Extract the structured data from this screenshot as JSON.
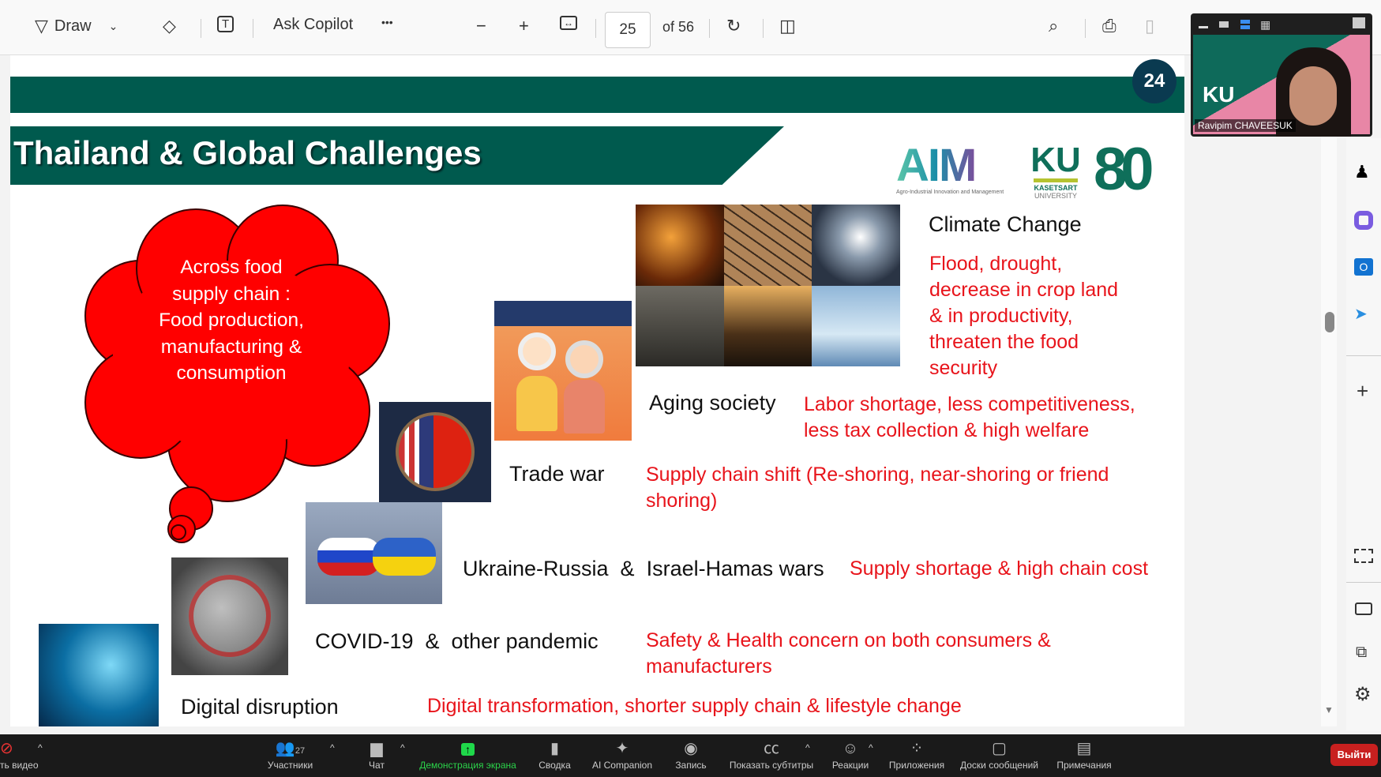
{
  "toolbar": {
    "draw": "Draw",
    "ask_copilot": "Ask Copilot",
    "more": "•••",
    "page_current": "25",
    "page_total": "of 56"
  },
  "slide": {
    "page_badge": "24",
    "title": "Thailand  & Global Challenges",
    "logos": {
      "aim": "AIM",
      "aim_sub": "Agro-Industrial Innovation and Management",
      "ku": "KU",
      "ku_sub1": "KASETSART",
      "ku_sub2": "UNIVERSITY",
      "anniv": "80"
    },
    "cloud_text": [
      "Across food",
      "supply chain :",
      "Food production,",
      "manufacturing &",
      "consumption"
    ],
    "challenges": [
      {
        "label": "Climate Change",
        "impact": [
          "Flood, drought,",
          "decrease in crop land",
          "& in productivity,",
          "threaten the food",
          "security"
        ]
      },
      {
        "label": "Aging society",
        "impact": [
          "Labor shortage, less competitiveness,",
          "less tax collection & high welfare"
        ]
      },
      {
        "label": "Trade war",
        "impact": [
          "Supply chain shift (Re-shoring, near-shoring or friend",
          "shoring)"
        ]
      },
      {
        "label": "Ukraine-Russia  &  Israel-Hamas wars",
        "impact": [
          "Supply shortage & high chain cost"
        ]
      },
      {
        "label": "COVID-19  &  other pandemic",
        "impact": [
          "Safety & Health concern on both consumers &",
          "manufacturers"
        ]
      },
      {
        "label": "Digital disruption",
        "impact": [
          "Digital transformation, shorter supply chain & lifestyle change"
        ]
      }
    ]
  },
  "video": {
    "participant": "Ravipim CHAVEESUK",
    "bg_text": "KU"
  },
  "bottom": {
    "video": "ть видео",
    "participants": "Участники",
    "participant_count": "27",
    "chat": "Чат",
    "share": "Демонстрация экрана",
    "summary": "Сводка",
    "ai": "AI Companion",
    "record": "Запись",
    "captions": "Показать субтитры",
    "reactions": "Реакции",
    "apps": "Приложения",
    "boards": "Доски сообщений",
    "notes": "Примечания",
    "leave": "Выйти"
  }
}
